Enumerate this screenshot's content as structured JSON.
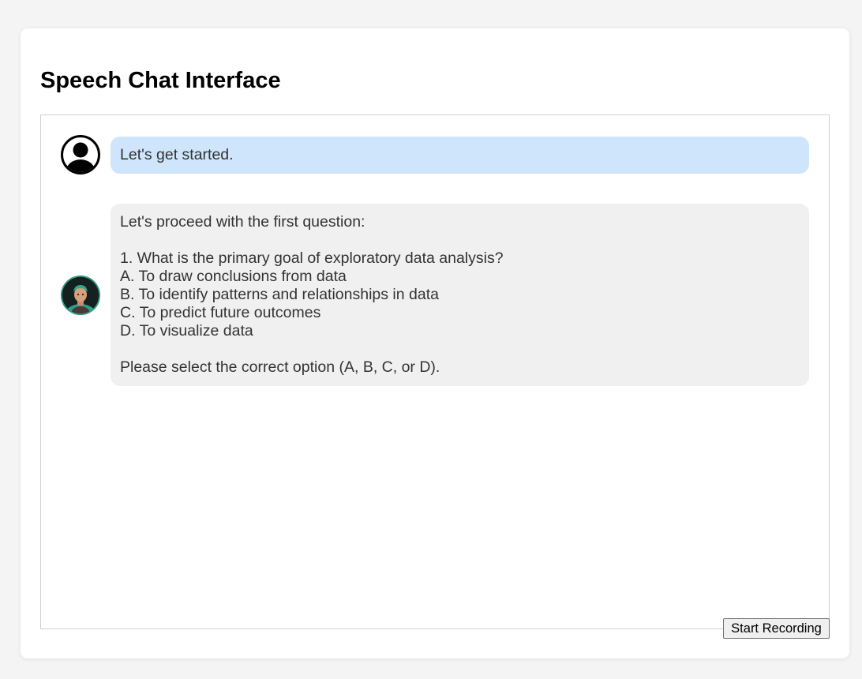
{
  "page": {
    "title": "Speech Chat Interface"
  },
  "messages": [
    {
      "role": "user",
      "avatar_icon": "user-silhouette-icon",
      "text": "Let's get started."
    },
    {
      "role": "assistant",
      "avatar_icon": "bot-avatar-icon",
      "text": "Let's proceed with the first question:\n\n1. What is the primary goal of exploratory data analysis?\nA. To draw conclusions from data\nB. To identify patterns and relationships in data\nC. To predict future outcomes\nD. To visualize data\n\nPlease select the correct option (A, B, C, or D)."
    }
  ],
  "controls": {
    "record_label": "Start Recording"
  },
  "colors": {
    "user_bubble": "#cfe5fb",
    "bot_bubble": "#f0f0f0",
    "page_background": "#f4f4f4"
  }
}
